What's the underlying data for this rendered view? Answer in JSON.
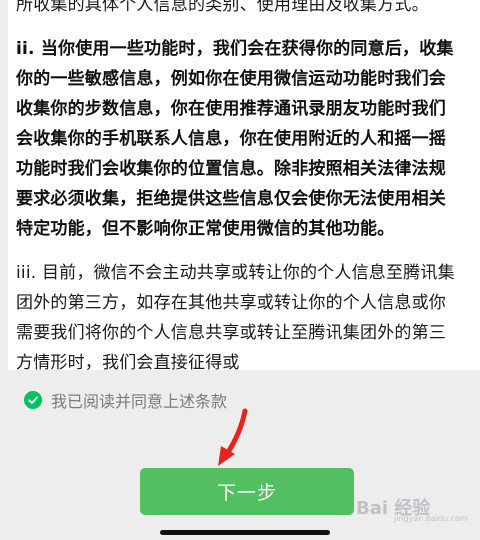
{
  "terms": {
    "para1": "所收集的具体个人信息的类别、使用理由及收集方式。",
    "para2": "ii. 当你使用一些功能时，我们会在获得你的同意后，收集你的一些敏感信息，例如你在使用微信运动功能时我们会收集你的步数信息，你在使用推荐通讯录朋友功能时我们会收集你的手机联系人信息，你在使用附近的人和摇一摇功能时我们会收集你的位置信息。除非按照相关法律法规要求必须收集，拒绝提供这些信息仅会使你无法使用相关特定功能，但不影响你正常使用微信的其他功能。",
    "para3": "iii. 目前，微信不会主动共享或转让你的个人信息至腾讯集团外的第三方，如存在其他共享或转让你的个人信息或你需要我们将你的个人信息共享或转让至腾讯集团外的第三方情形时，我们会直接征得或"
  },
  "agreement": {
    "label": "我已阅读并同意上述条款",
    "checked": true
  },
  "next_button": {
    "label": "下一步"
  },
  "watermark": {
    "logo": "Bai 经验",
    "url": "jingyan.baidu.com"
  },
  "colors": {
    "accent_green": "#07c160",
    "button_green": "#52c060",
    "annotation_red": "#e8231f",
    "background": "#ededed"
  },
  "icons": {
    "check": "check-circle-icon",
    "annotation": "red-arrow-icon"
  }
}
